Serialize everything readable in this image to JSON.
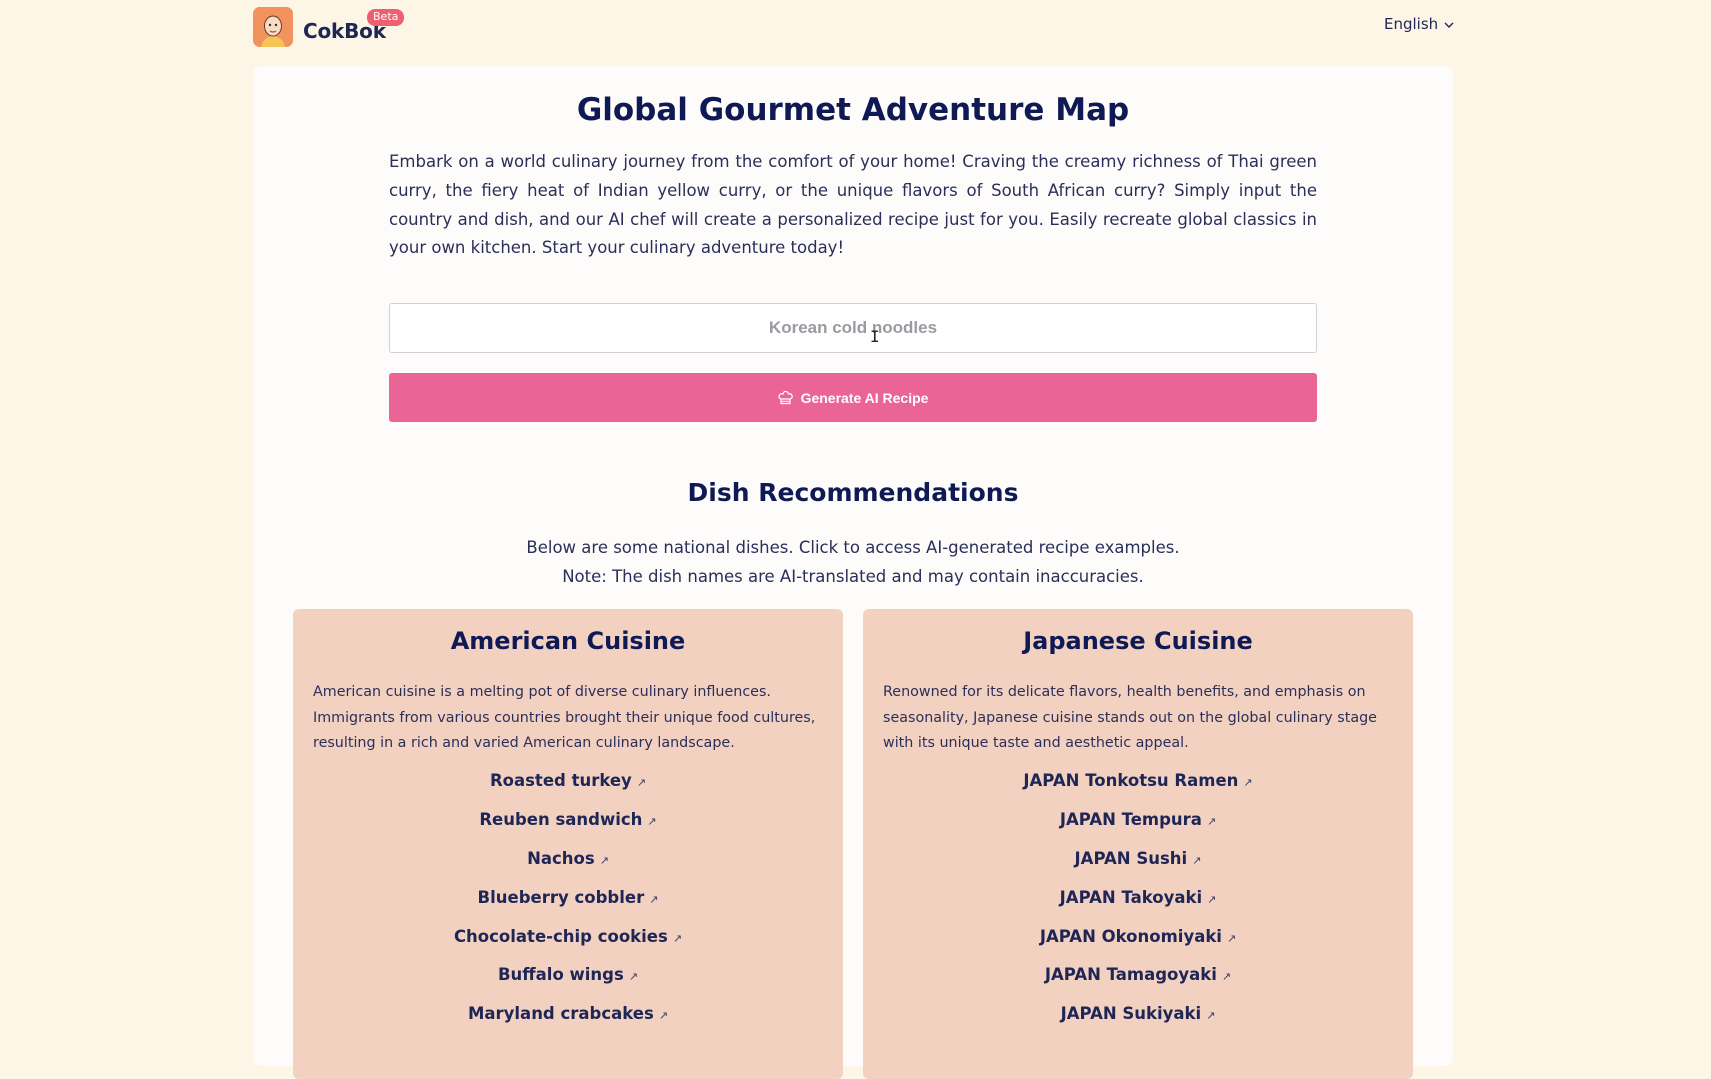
{
  "header": {
    "brand": "CokBok",
    "badge": "Beta",
    "language": "English"
  },
  "hero": {
    "title": "Global Gourmet Adventure Map",
    "intro": "Embark on a world culinary journey from the comfort of your home! Craving the creamy richness of Thai green curry, the fiery heat of Indian yellow curry, or the unique flavors of South African curry? Simply input the country and dish, and our AI chef will create a personalized recipe just for you. Easily recreate global classics in your own kitchen. Start your culinary adventure today!",
    "search_placeholder": "Korean cold noodles",
    "generate_label": "Generate AI Recipe"
  },
  "recommendations": {
    "title": "Dish Recommendations",
    "line1": "Below are some national dishes. Click to access AI-generated recipe examples.",
    "line2": "Note: The dish names are AI-translated and may contain inaccuracies."
  },
  "cards": [
    {
      "title": "American Cuisine",
      "desc": "American cuisine is a melting pot of diverse culinary influences. Immigrants from various countries brought their unique food cultures, resulting in a rich and varied American culinary landscape.",
      "dishes": [
        "Roasted turkey",
        "Reuben sandwich",
        "Nachos",
        "Blueberry cobbler",
        "Chocolate-chip cookies",
        "Buffalo wings",
        "Maryland crabcakes"
      ]
    },
    {
      "title": "Japanese Cuisine",
      "desc": "Renowned for its delicate flavors, health benefits, and emphasis on seasonality, Japanese cuisine stands out on the global culinary stage with its unique taste and aesthetic appeal.",
      "dishes": [
        "JAPAN Tonkotsu Ramen",
        "JAPAN Tempura",
        "JAPAN Sushi",
        "JAPAN Takoyaki",
        "JAPAN Okonomiyaki",
        "JAPAN Tamagoyaki",
        "JAPAN Sukiyaki"
      ]
    }
  ],
  "icons": {
    "dish_link": "external-link-icon",
    "generate": "chef-hat-icon",
    "language": "chevron-down-icon"
  },
  "colors": {
    "background": "#fdf6e6",
    "accent": "#eb6496",
    "card": "#f3d1c1",
    "heading": "#0f1a55",
    "badge": "#ee5f70"
  }
}
